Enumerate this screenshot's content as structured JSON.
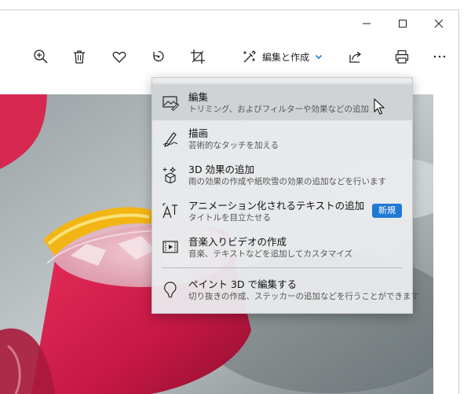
{
  "window": {
    "controls": {
      "minimize_icon": "minimize-icon",
      "maximize_icon": "maximize-icon",
      "close_icon": "close-icon"
    }
  },
  "toolbar": {
    "edit_create_label": "編集と作成",
    "icons": [
      "zoom-in-icon",
      "delete-icon",
      "favorite-icon",
      "rotate-icon",
      "crop-icon",
      "share-icon",
      "print-icon",
      "more-icon"
    ]
  },
  "menu": {
    "items": [
      {
        "title": "編集",
        "desc": "トリミング、およびフィルターや効果などの追加",
        "icon": "photo-edit-icon"
      },
      {
        "title": "描画",
        "desc": "芸術的なタッチを加える",
        "icon": "draw-icon"
      },
      {
        "title": "3D 効果の追加",
        "desc": "雨の効果の作成や紙吹雪の効果の追加などを行います",
        "icon": "3d-effects-icon"
      },
      {
        "title": "アニメーション化されるテキストの追加",
        "desc": "タイトルを目立たせる",
        "icon": "animated-text-icon",
        "badge": "新規"
      },
      {
        "title": "音楽入りビデオの作成",
        "desc": "音楽、テキストなどを追加してカスタマイズ",
        "icon": "video-icon"
      },
      {
        "title": "ペイント 3D で編集する",
        "desc": "切り抜きの作成、ステッカーの追加などを行うことができます",
        "icon": "paint3d-icon"
      }
    ]
  },
  "colors": {
    "accent": "#2079d2",
    "menu_bg": "#e9ebed",
    "drink": "#d0204a"
  }
}
